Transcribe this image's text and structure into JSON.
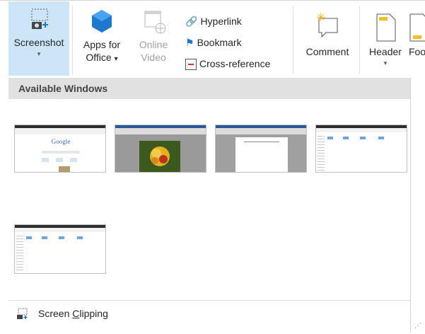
{
  "ribbon": {
    "screenshot": {
      "label": "Screenshot",
      "caret": "▾"
    },
    "apps_for_office": {
      "line1": "Apps for",
      "line2": "Office",
      "caret": "▾"
    },
    "online_video": {
      "line1": "Online",
      "line2": "Video"
    },
    "links": [
      {
        "label": "Hyperlink",
        "icon": "hyperlink-icon"
      },
      {
        "label": "Bookmark",
        "icon": "bookmark-flag-icon"
      },
      {
        "label": "Cross-reference",
        "icon": "cross-reference-icon"
      }
    ],
    "comment": {
      "label": "Comment"
    },
    "header": {
      "label": "Header",
      "caret": "▾"
    },
    "footer": {
      "label": "Foo"
    }
  },
  "panel": {
    "title": "Available Windows",
    "screen_clipping": {
      "before": "Screen ",
      "accel": "C",
      "after": "lipping"
    }
  },
  "thumbnails": [
    {
      "name": "google-window",
      "google_text": "Google"
    },
    {
      "name": "word-flower-window"
    },
    {
      "name": "word-document-window"
    },
    {
      "name": "explorer-window-1"
    },
    {
      "name": "explorer-window-2"
    }
  ],
  "colors": {
    "selected_bg": "#cde6f7",
    "header_bg": "#e1e1e1",
    "office_blue": "#1e78d0"
  }
}
